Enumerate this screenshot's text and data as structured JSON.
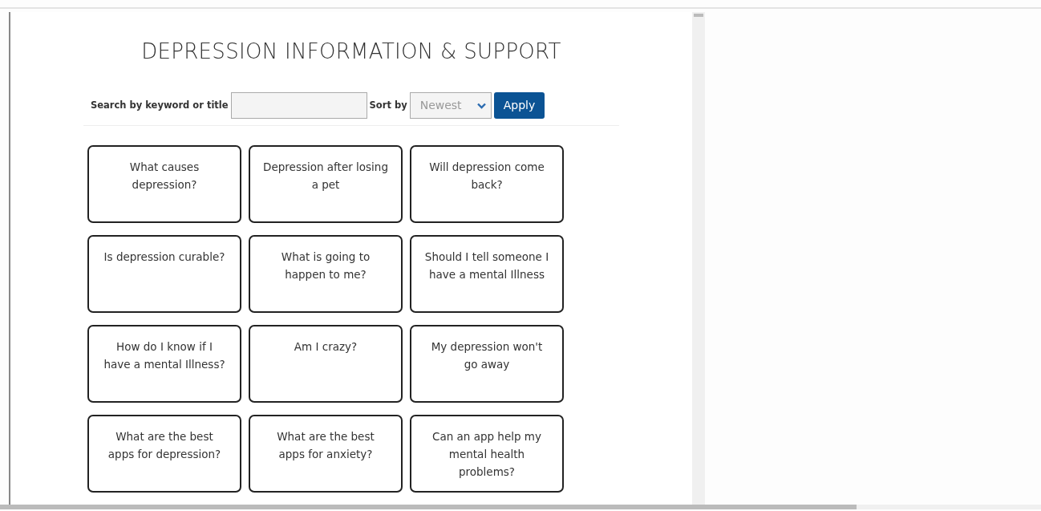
{
  "title": "DEPRESSION INFORMATION & SUPPORT",
  "filter": {
    "search_label": "Search by keyword or title",
    "sort_label": "Sort by",
    "sort_value": "Newest",
    "apply_label": "Apply"
  },
  "topics": [
    {
      "text": "What causes depression?"
    },
    {
      "text": "Depression after losing a pet"
    },
    {
      "text": "Will depression come back?"
    },
    {
      "text": "Is depression curable?"
    },
    {
      "text": "What is going to happen to me?"
    },
    {
      "text": "Should I tell someone I have a mental Illness"
    },
    {
      "text": "How do I know if I have a mental Illness?"
    },
    {
      "text": "Am I crazy?"
    },
    {
      "text": "My depression won't go away"
    },
    {
      "text": "What are the best apps for depression?"
    },
    {
      "text": "What are the best apps for anxiety?"
    },
    {
      "text": "Can an app help my mental health problems?"
    }
  ]
}
